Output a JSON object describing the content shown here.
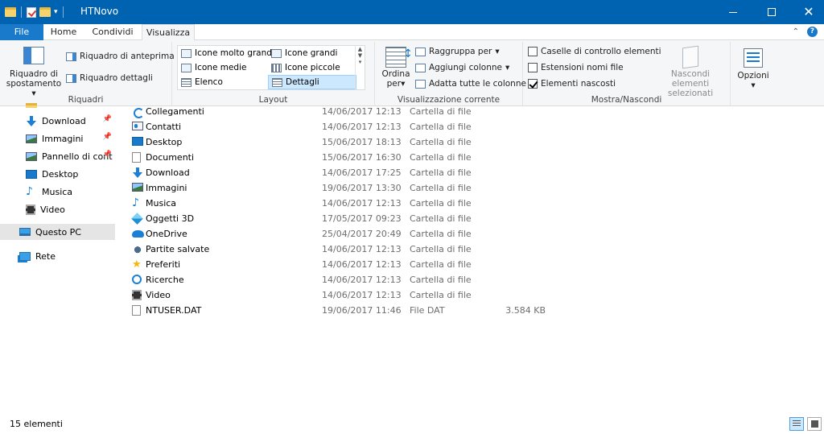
{
  "window": {
    "title": "HTNovo"
  },
  "tabs": [
    "File",
    "Home",
    "Condividi",
    "Visualizza"
  ],
  "ribbon": {
    "panes": {
      "nav_pane_line1": "Riquadro di",
      "nav_pane_line2": "spostamento",
      "preview_pane": "Riquadro di anteprima",
      "details_pane": "Riquadro dettagli",
      "label": "Riquadri"
    },
    "layout": {
      "items": [
        "Icone molto grandi",
        "Icone grandi",
        "Icone medie",
        "Icone piccole",
        "Elenco",
        "Dettagli"
      ],
      "selected": "Dettagli",
      "label": "Layout"
    },
    "current_view": {
      "sort_line1": "Ordina",
      "sort_line2": "per",
      "group_by": "Raggruppa per",
      "add_columns": "Aggiungi colonne",
      "fit_columns": "Adatta tutte le colonne",
      "label": "Visualizzazione corrente"
    },
    "show_hide": {
      "item_checkboxes": "Caselle di controllo elementi",
      "item_checkboxes_checked": false,
      "extensions": "Estensioni nomi file",
      "extensions_checked": false,
      "hidden_items": "Elementi nascosti",
      "hidden_items_checked": true,
      "hide_selected_line1": "Nascondi elementi",
      "hide_selected_line2": "selezionati",
      "label": "Mostra/Nascondi"
    },
    "options": {
      "label": "Opzioni"
    }
  },
  "nav": {
    "items": [
      {
        "label": "Download",
        "icon": "download-icon",
        "pinned": true
      },
      {
        "label": "Immagini",
        "icon": "pictures-icon",
        "pinned": true
      },
      {
        "label": "Pannello di cont",
        "icon": "control-panel-icon",
        "pinned": true
      },
      {
        "label": "Desktop",
        "icon": "desktop-icon",
        "pinned": false
      },
      {
        "label": "Musica",
        "icon": "music-icon",
        "pinned": false
      },
      {
        "label": "Video",
        "icon": "video-icon",
        "pinned": false
      },
      {
        "label": "Questo PC",
        "icon": "this-pc-icon",
        "pinned": false,
        "selected": true
      },
      {
        "label": "Rete",
        "icon": "network-icon",
        "pinned": false
      }
    ]
  },
  "files": [
    {
      "name": "Collegamenti",
      "date": "14/06/2017 12:13",
      "type": "Cartella di file",
      "size": "",
      "icon": "links-icon"
    },
    {
      "name": "Contatti",
      "date": "14/06/2017 12:13",
      "type": "Cartella di file",
      "size": "",
      "icon": "contacts-icon"
    },
    {
      "name": "Desktop",
      "date": "15/06/2017 18:13",
      "type": "Cartella di file",
      "size": "",
      "icon": "desktop-icon"
    },
    {
      "name": "Documenti",
      "date": "15/06/2017 16:30",
      "type": "Cartella di file",
      "size": "",
      "icon": "documents-icon"
    },
    {
      "name": "Download",
      "date": "14/06/2017 17:25",
      "type": "Cartella di file",
      "size": "",
      "icon": "download-icon"
    },
    {
      "name": "Immagini",
      "date": "19/06/2017 13:30",
      "type": "Cartella di file",
      "size": "",
      "icon": "pictures-icon"
    },
    {
      "name": "Musica",
      "date": "14/06/2017 12:13",
      "type": "Cartella di file",
      "size": "",
      "icon": "music-icon"
    },
    {
      "name": "Oggetti 3D",
      "date": "17/05/2017 09:23",
      "type": "Cartella di file",
      "size": "",
      "icon": "3d-objects-icon"
    },
    {
      "name": "OneDrive",
      "date": "25/04/2017 20:49",
      "type": "Cartella di file",
      "size": "",
      "icon": "onedrive-icon"
    },
    {
      "name": "Partite salvate",
      "date": "14/06/2017 12:13",
      "type": "Cartella di file",
      "size": "",
      "icon": "saved-games-icon"
    },
    {
      "name": "Preferiti",
      "date": "14/06/2017 12:13",
      "type": "Cartella di file",
      "size": "",
      "icon": "favorites-icon"
    },
    {
      "name": "Ricerche",
      "date": "14/06/2017 12:13",
      "type": "Cartella di file",
      "size": "",
      "icon": "searches-icon"
    },
    {
      "name": "Video",
      "date": "14/06/2017 12:13",
      "type": "Cartella di file",
      "size": "",
      "icon": "video-icon"
    },
    {
      "name": "NTUSER.DAT",
      "date": "19/06/2017 11:46",
      "type": "File DAT",
      "size": "3.584 KB",
      "icon": "file-icon"
    }
  ],
  "status": {
    "count": "15 elementi"
  },
  "colors": {
    "titlebar": "#0063b1",
    "file_tab": "#1979ca",
    "selection": "#cce8ff"
  }
}
